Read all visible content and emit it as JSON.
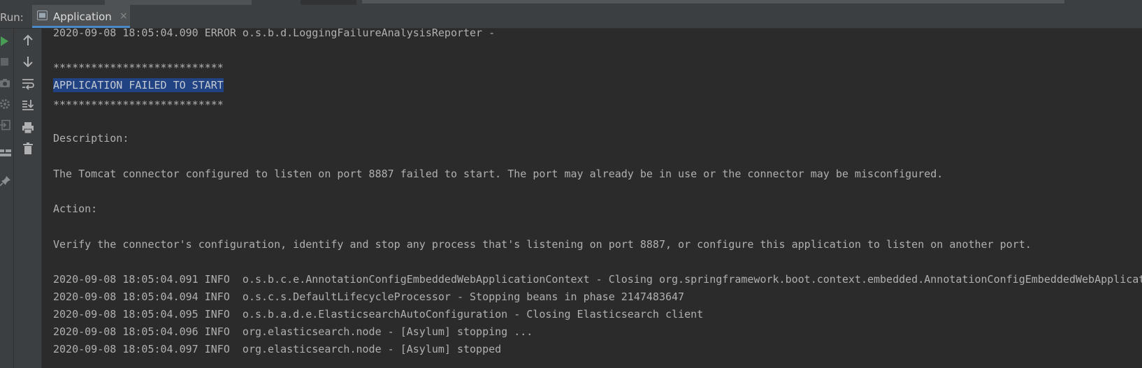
{
  "run_panel": {
    "label": "Run:",
    "tab": {
      "label": "Application",
      "close": "×"
    }
  },
  "console": {
    "lines": [
      "2020-09-08 18:05:04.090 ERROR o.s.b.d.LoggingFailureAnalysisReporter -",
      "",
      "***************************",
      "APPLICATION FAILED TO START",
      "***************************",
      "Description:",
      "The Tomcat connector configured to listen on port 8887 failed to start. The port may already be in use or the connector may be misconfigured.",
      "Action:",
      "Verify the connector's configuration, identify and stop any process that's listening on port 8887, or configure this application to listen on another port.",
      "2020-09-08 18:05:04.091 INFO  o.s.b.c.e.AnnotationConfigEmbeddedWebApplicationContext - Closing org.springframework.boot.context.embedded.AnnotationConfigEmbeddedWebApplicationContext",
      "2020-09-08 18:05:04.094 INFO  o.s.c.s.DefaultLifecycleProcessor - Stopping beans in phase 2147483647",
      "2020-09-08 18:05:04.095 INFO  o.s.b.a.d.e.ElasticsearchAutoConfiguration - Closing Elasticsearch client",
      "2020-09-08 18:05:04.096 INFO  org.elasticsearch.node - [Asylum] stopping ...",
      "2020-09-08 18:05:04.097 INFO  org.elasticsearch.node - [Asylum] stopped"
    ],
    "selected_line_index": 3
  },
  "colors": {
    "background": "#2b2b2b",
    "toolbar": "#3c3f41",
    "selection": "#214283",
    "run_green": "#499c54",
    "tab_underline": "#4a88c7"
  },
  "icons": {
    "left_toolbar": [
      "rerun-icon",
      "stop-icon",
      "camera-icon",
      "settings-icon",
      "exit-icon",
      "layout-icon",
      "pin-icon"
    ],
    "console_toolbar": [
      "arrow-up-icon",
      "arrow-down-icon",
      "soft-wrap-icon",
      "scroll-to-end-icon",
      "print-icon",
      "trash-icon"
    ]
  }
}
